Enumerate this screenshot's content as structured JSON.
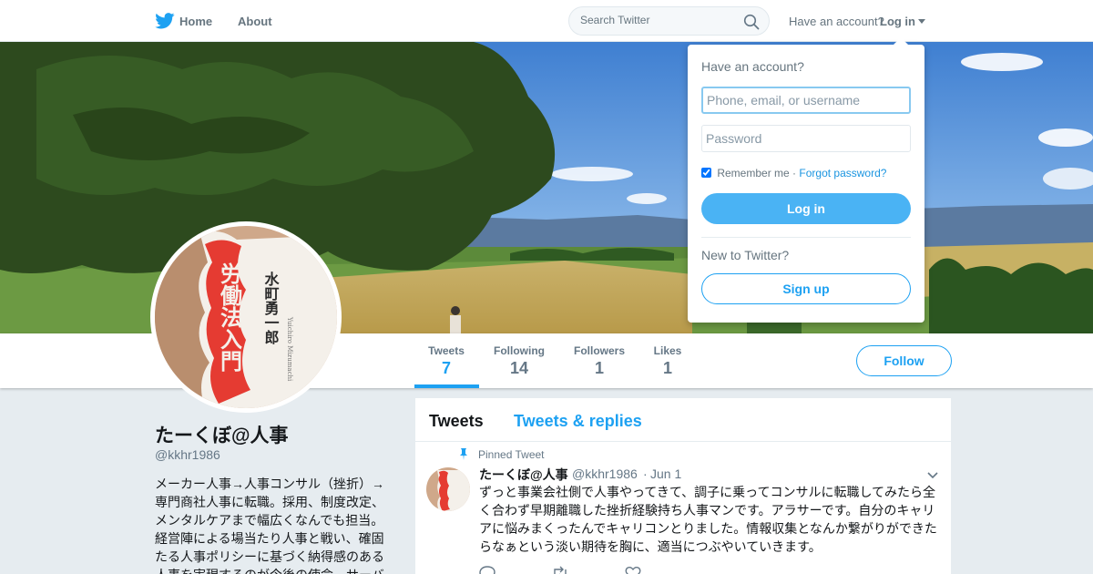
{
  "topbar": {
    "logo_icon": "twitter-bird-icon",
    "home_label": "Home",
    "about_label": "About",
    "search_placeholder": "Search Twitter",
    "search_icon": "search-icon",
    "have_account": "Have an account?",
    "login_label": "Log in"
  },
  "profile": {
    "display_name": "たーくぼ@人事",
    "handle": "@kkhr1986",
    "bio": "メーカー人事→人事コンサル（挫折）→専門商社人事に転職。採用、制度改定、メンタルケアまで幅広くなんでも担当。経営陣による場当たり人事と戦い、確固たる人事ポリシーに基づく納得感のある人事を実現するのが今後の使命。サーバ",
    "avatar_text": {
      "title": "労働法入門",
      "author": "水町勇一郎",
      "romaji": "Yuichiro Mizumachi"
    },
    "follow_label": "Follow"
  },
  "stats": [
    {
      "label": "Tweets",
      "value": "7"
    },
    {
      "label": "Following",
      "value": "14"
    },
    {
      "label": "Followers",
      "value": "1"
    },
    {
      "label": "Likes",
      "value": "1"
    }
  ],
  "timeline": {
    "tabs": [
      "Tweets",
      "Tweets & replies"
    ],
    "pinned_label": "Pinned Tweet",
    "tweet": {
      "name": "たーくぼ@人事",
      "handle": "@kkhr1986",
      "separator": "·",
      "date": "Jun 1",
      "text": "ずっと事業会社側で人事やってきて、調子に乗ってコンサルに転職してみたら全く合わず早期離職した挫折経験持ち人事マンです。アラサーです。自分のキャリアに悩みまくったんでキャリコンとりました。情報収集となんか繋がりができたらなぁという淡い期待を胸に、適当につぶやいていきます。"
    }
  },
  "login_dropdown": {
    "title": "Have an account?",
    "username_placeholder": "Phone, email, or username",
    "password_placeholder": "Password",
    "remember_label": "Remember me",
    "separator": "·",
    "forgot_label": "Forgot password?",
    "login_button": "Log in",
    "new_label": "New to Twitter?",
    "signup_button": "Sign up"
  },
  "colors": {
    "brand_blue": "#1da1f2",
    "avatar_red": "#e53b32",
    "page_bg": "#e6ecf0"
  }
}
